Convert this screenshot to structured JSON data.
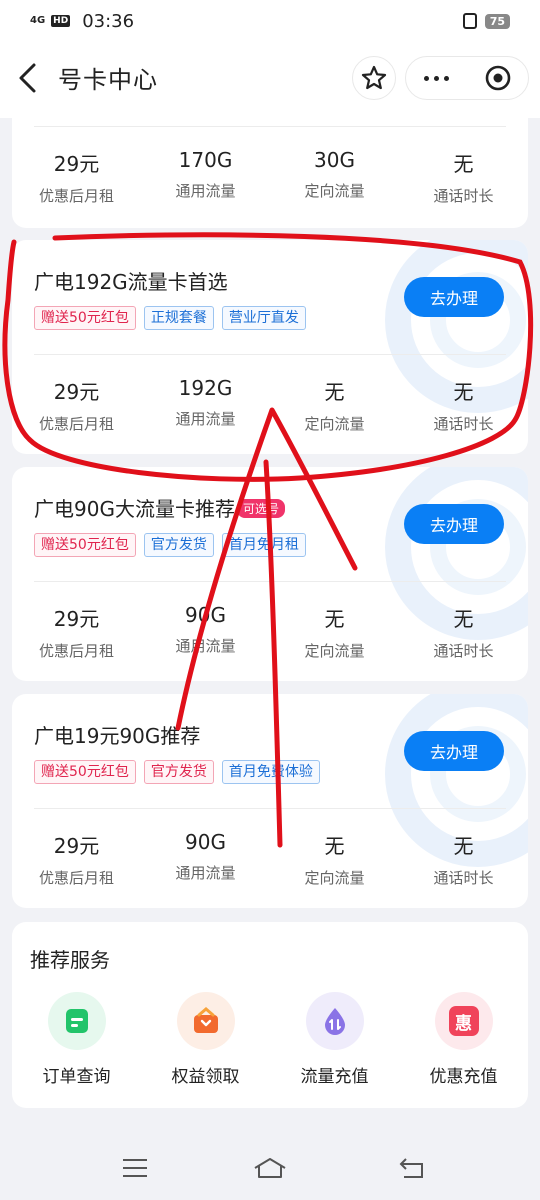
{
  "status": {
    "network": "4G",
    "hd": "HD",
    "time": "03:36",
    "battery": "75"
  },
  "header": {
    "title": "号卡中心"
  },
  "cards": [
    {
      "stats": [
        {
          "value": "29元",
          "label": "优惠后月租"
        },
        {
          "value": "170G",
          "label": "通用流量"
        },
        {
          "value": "30G",
          "label": "定向流量"
        },
        {
          "value": "无",
          "label": "通话时长"
        }
      ]
    },
    {
      "title": "广电192G流量卡首选",
      "button": "去办理",
      "tags": [
        {
          "text": "赠送50元红包",
          "style": "red"
        },
        {
          "text": "正规套餐",
          "style": "blue"
        },
        {
          "text": "营业厅直发",
          "style": "blue"
        }
      ],
      "stats": [
        {
          "value": "29元",
          "label": "优惠后月租"
        },
        {
          "value": "192G",
          "label": "通用流量"
        },
        {
          "value": "无",
          "label": "定向流量"
        },
        {
          "value": "无",
          "label": "通话时长"
        }
      ]
    },
    {
      "title": "广电90G大流量卡推荐",
      "badge": "可选号",
      "button": "去办理",
      "tags": [
        {
          "text": "赠送50元红包",
          "style": "red"
        },
        {
          "text": "官方发货",
          "style": "blue"
        },
        {
          "text": "首月免月租",
          "style": "blue"
        }
      ],
      "stats": [
        {
          "value": "29元",
          "label": "优惠后月租"
        },
        {
          "value": "90G",
          "label": "通用流量"
        },
        {
          "value": "无",
          "label": "定向流量"
        },
        {
          "value": "无",
          "label": "通话时长"
        }
      ]
    },
    {
      "title": "广电19元90G推荐",
      "button": "去办理",
      "tags": [
        {
          "text": "赠送50元红包",
          "style": "red"
        },
        {
          "text": "官方发货",
          "style": "red"
        },
        {
          "text": "首月免费体验",
          "style": "blue"
        }
      ],
      "stats": [
        {
          "value": "29元",
          "label": "优惠后月租"
        },
        {
          "value": "90G",
          "label": "通用流量"
        },
        {
          "value": "无",
          "label": "定向流量"
        },
        {
          "value": "无",
          "label": "通话时长"
        }
      ]
    }
  ],
  "services": {
    "title": "推荐服务",
    "items": [
      {
        "label": "订单查询",
        "icon": "order-icon",
        "color": "#22c46a"
      },
      {
        "label": "权益领取",
        "icon": "gift-icon",
        "color": "#f26a2e"
      },
      {
        "label": "流量充值",
        "icon": "data-icon",
        "color": "#8a73e6"
      },
      {
        "label": "优惠充值",
        "icon": "discount-icon",
        "color": "#f0435a"
      }
    ],
    "discount_glyph": "惠"
  },
  "colors": {
    "accent": "#0a7ff5",
    "scribble": "#e0101a"
  }
}
